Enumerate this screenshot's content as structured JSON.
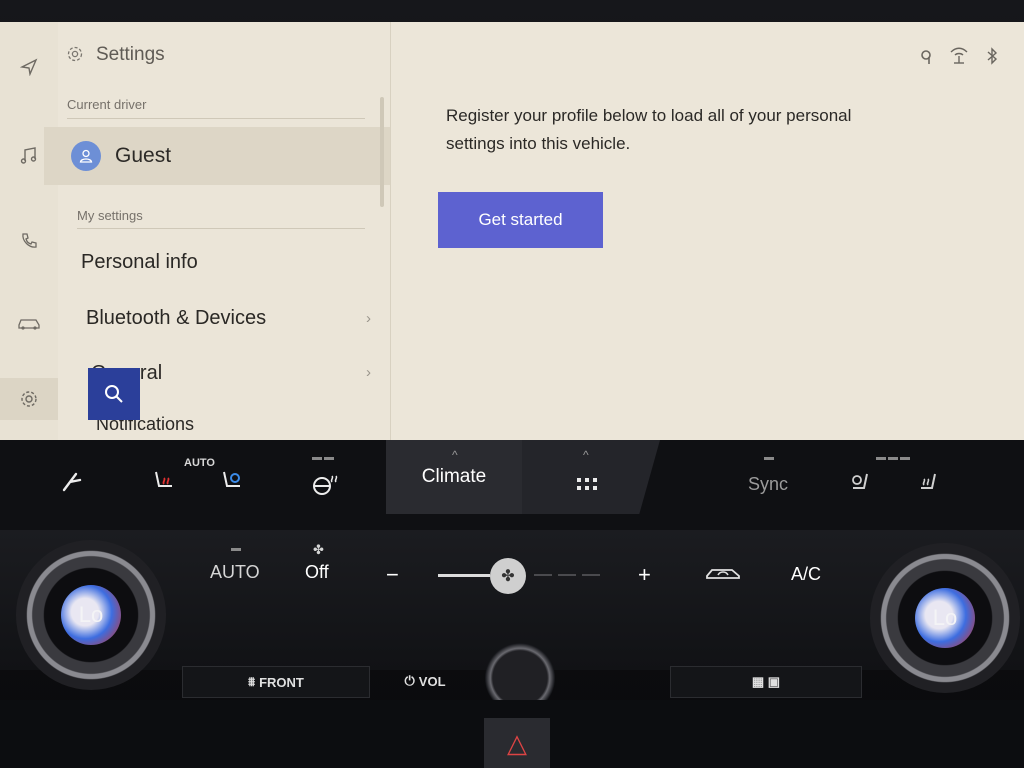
{
  "screen": {
    "header": {
      "title": "Settings"
    },
    "current_driver_label": "Current driver",
    "driver_name": "Guest",
    "my_settings_label": "My settings",
    "menu_items": [
      {
        "label": "Personal info"
      },
      {
        "label": "Bluetooth & Devices"
      },
      {
        "label": "General"
      },
      {
        "label": "Notifications"
      }
    ],
    "register_text": "Register your profile below to load all of your personal settings into this vehicle.",
    "get_started_label": "Get started",
    "status_icons": [
      "qi-charging-icon",
      "wifi-hotspot-icon",
      "bluetooth-icon"
    ],
    "rail_icons": [
      "navigation-icon",
      "music-icon",
      "phone-icon",
      "car-icon",
      "settings-icon"
    ]
  },
  "hvac_strip": {
    "auto_label": "AUTO",
    "climate_label": "Climate",
    "sync_label": "Sync"
  },
  "climate_controls": {
    "auto_label": "AUTO",
    "fan_state": "Off",
    "minus": "−",
    "plus": "+",
    "ac_label": "A/C",
    "left_temp": "Lo",
    "right_temp": "Lo"
  },
  "physical_buttons": {
    "front_defrost": "FRONT",
    "volume": "VOL"
  }
}
